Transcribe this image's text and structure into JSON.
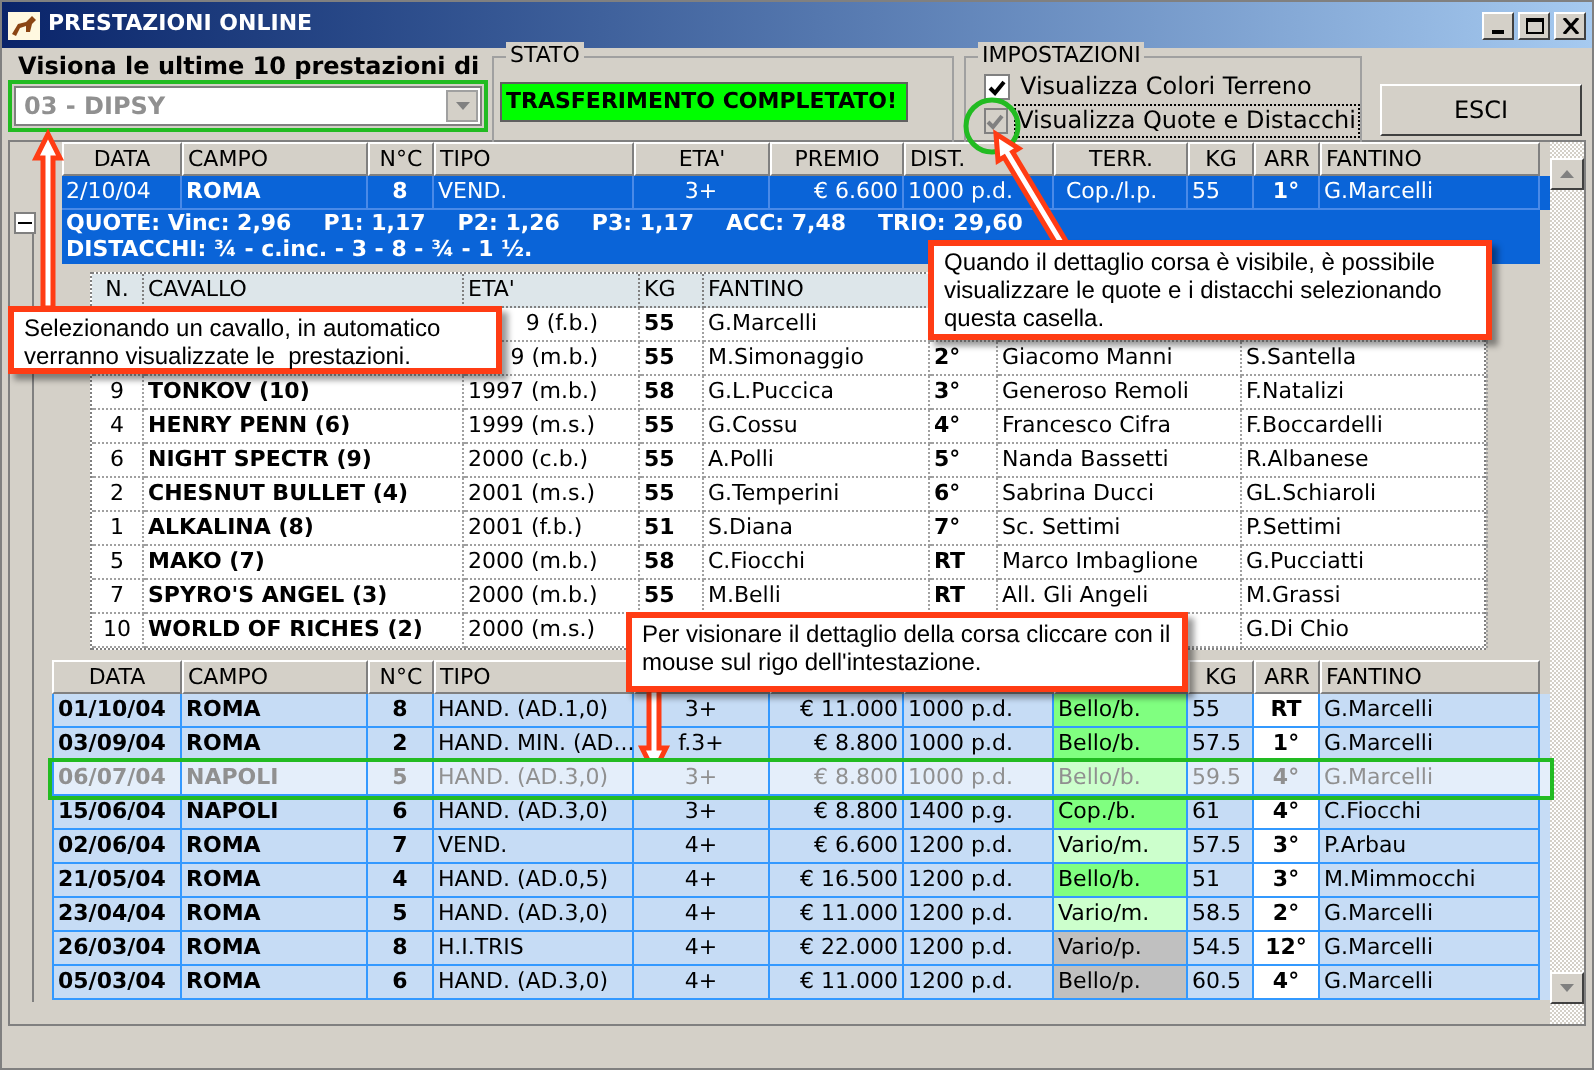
{
  "window": {
    "title": "PRESTAZIONI ONLINE"
  },
  "horse_picker": {
    "label": "Visiona le ultime 10 prestazioni di",
    "value": "03 - DIPSY"
  },
  "stato": {
    "title": "STATO",
    "message": "TRASFERIMENTO COMPLETATO!"
  },
  "impostazioni": {
    "title": "IMPOSTAZIONI",
    "options": [
      {
        "label": "Visualizza Colori Terreno",
        "checked": true,
        "disabled": false
      },
      {
        "label": "Visualizza Quote e Distacchi",
        "checked": true,
        "disabled": true
      }
    ]
  },
  "exit_button": "ESCI",
  "races_table": {
    "columns": [
      "DATA",
      "CAMPO",
      "N°C",
      "TIPO",
      "ETA'",
      "PREMIO",
      "DIST.",
      "TERR.",
      "KG",
      "ARR",
      "FANTINO"
    ],
    "row": {
      "selected": true,
      "expanded": true,
      "cells": [
        "2/10/04",
        "ROMA",
        "8",
        "VEND.",
        "3+",
        "€ 6.600",
        "1000 p.d.",
        "Cop./l.p.",
        "55",
        "1°",
        "G.Marcelli"
      ],
      "quote": [
        "QUOTE: Vinc: 2,96",
        "P1: 1,17",
        "P2: 1,26",
        "P3: 1,17",
        "ACC: 7,48",
        "TRIO: 29,60"
      ],
      "distacchi": "DISTACCHI: ¾ - c.inc. - 3 - 8 - ¾ - 1 ½."
    }
  },
  "runners_table": {
    "columns": [
      "N.",
      "CAVALLO",
      "ETA'",
      "KG",
      "FANTINO"
    ],
    "rows": [
      {
        "cells": [
          null,
          null,
          "9 (f.b.)",
          "55",
          "G.Marcelli",
          null,
          null,
          null
        ]
      },
      {
        "cells": [
          null,
          null,
          "9 (m.b.)",
          "55",
          "M.Simonaggio",
          "2°",
          "Giacomo Manni",
          "S.Santella"
        ]
      },
      {
        "cells": [
          "9",
          "TONKOV (10)",
          "1997 (m.b.)",
          "58",
          "G.L.Puccica",
          "3°",
          "Generoso Remoli",
          "F.Natalizi"
        ]
      },
      {
        "cells": [
          "4",
          "HENRY PENN (6)",
          "1999 (m.s.)",
          "55",
          "G.Cossu",
          "4°",
          "Francesco Cifra",
          "F.Boccardelli"
        ]
      },
      {
        "cells": [
          "6",
          "NIGHT SPECTR (9)",
          "2000 (c.b.)",
          "55",
          "A.Polli",
          "5°",
          "Nanda Bassetti",
          "R.Albanese"
        ]
      },
      {
        "cells": [
          "2",
          "CHESNUT BULLET (4)",
          "2001 (m.s.)",
          "55",
          "G.Temperini",
          "6°",
          "Sabrina Ducci",
          "GL.Schiaroli"
        ]
      },
      {
        "cells": [
          "1",
          "ALKALINA (8)",
          "2001 (f.b.)",
          "51",
          "S.Diana",
          "7°",
          "Sc. Settimi",
          "P.Settimi"
        ]
      },
      {
        "cells": [
          "5",
          "MAKO (7)",
          "2000 (m.b.)",
          "58",
          "C.Fiocchi",
          "RT",
          "Marco Imbaglione",
          "G.Pucciatti"
        ]
      },
      {
        "cells": [
          "7",
          "SPYRO'S ANGEL (3)",
          "2000 (m.b.)",
          "55",
          "M.Belli",
          "RT",
          "All. Gli Angeli",
          "M.Grassi"
        ]
      },
      {
        "cells": [
          "10",
          "WORLD OF RICHES (2)",
          "2000 (m.s.)",
          null,
          null,
          null,
          null,
          "G.Di Chio"
        ]
      }
    ]
  },
  "history_table": {
    "columns": [
      "DATA",
      "CAMPO",
      "N°C",
      "TIPO",
      null,
      null,
      null,
      null,
      "KG",
      "ARR",
      "FANTINO"
    ],
    "rows": [
      {
        "selected": false,
        "color": "#80ff80",
        "cells": [
          "01/10/04",
          "ROMA",
          "8",
          "HAND. (AD.1,0)",
          "3+",
          "€ 11.000",
          "1000 p.d.",
          "Bello/b.",
          "55",
          "RT",
          "G.Marcelli"
        ]
      },
      {
        "selected": false,
        "color": "#80ff80",
        "cells": [
          "03/09/04",
          "ROMA",
          "2",
          "HAND. MIN. (AD...",
          "f.3+",
          "€ 8.800",
          "1000 p.d.",
          "Bello/b.",
          "57.5",
          "1°",
          "G.Marcelli"
        ]
      },
      {
        "selected": true,
        "color": "#ccffcc",
        "cells": [
          "06/07/04",
          "NAPOLI",
          "5",
          "HAND. (AD.3,0)",
          "3+",
          "€ 8.800",
          "1000 p.d.",
          "Bello/b.",
          "59.5",
          "4°",
          "G.Marcelli"
        ]
      },
      {
        "selected": false,
        "color": "#80ff80",
        "cells": [
          "15/06/04",
          "NAPOLI",
          "6",
          "HAND. (AD.3,0)",
          "3+",
          "€ 8.800",
          "1400 p.g.",
          "Cop./b.",
          "61",
          "4°",
          "C.Fiocchi"
        ]
      },
      {
        "selected": false,
        "color": "#ccffcc",
        "cells": [
          "02/06/04",
          "ROMA",
          "7",
          "VEND.",
          "4+",
          "€ 6.600",
          "1200 p.d.",
          "Vario/m.",
          "57.5",
          "3°",
          "P.Arbau"
        ]
      },
      {
        "selected": false,
        "color": "#80ff80",
        "cells": [
          "21/05/04",
          "ROMA",
          "4",
          "HAND. (AD.0,5)",
          "4+",
          "€ 16.500",
          "1200 p.d.",
          "Bello/b.",
          "51",
          "3°",
          "M.Mimmocchi"
        ]
      },
      {
        "selected": false,
        "color": "#ccffcc",
        "cells": [
          "23/04/04",
          "ROMA",
          "5",
          "HAND. (AD.3,0)",
          "4+",
          "€ 11.000",
          "1200 p.d.",
          "Vario/m.",
          "58.5",
          "2°",
          "G.Marcelli"
        ]
      },
      {
        "selected": false,
        "color": "#c0c0c0",
        "cells": [
          "26/03/04",
          "ROMA",
          "8",
          "H.I.TRIS",
          "4+",
          "€ 22.000",
          "1200 p.d.",
          "Vario/p.",
          "54.5",
          "12°",
          "G.Marcelli"
        ]
      },
      {
        "selected": false,
        "color": "#c0c0c0",
        "cells": [
          "05/03/04",
          "ROMA",
          "6",
          "HAND. (AD.3,0)",
          "4+",
          "€ 11.000",
          "1200 p.d.",
          "Bello/p.",
          "60.5",
          "4°",
          "G.Marcelli"
        ]
      }
    ]
  },
  "callouts": [
    {
      "text": "Selezionando un cavallo, in automatico verranno visualizzate le  prestazioni."
    },
    {
      "text": "Quando il dettaglio corsa è visibile, è possibile visualizzare le quote e i distacchi selezionando questa casella."
    },
    {
      "text": "Per visionare il dettaglio della corsa cliccare con il mouse sul rigo dell'intestazione."
    }
  ]
}
